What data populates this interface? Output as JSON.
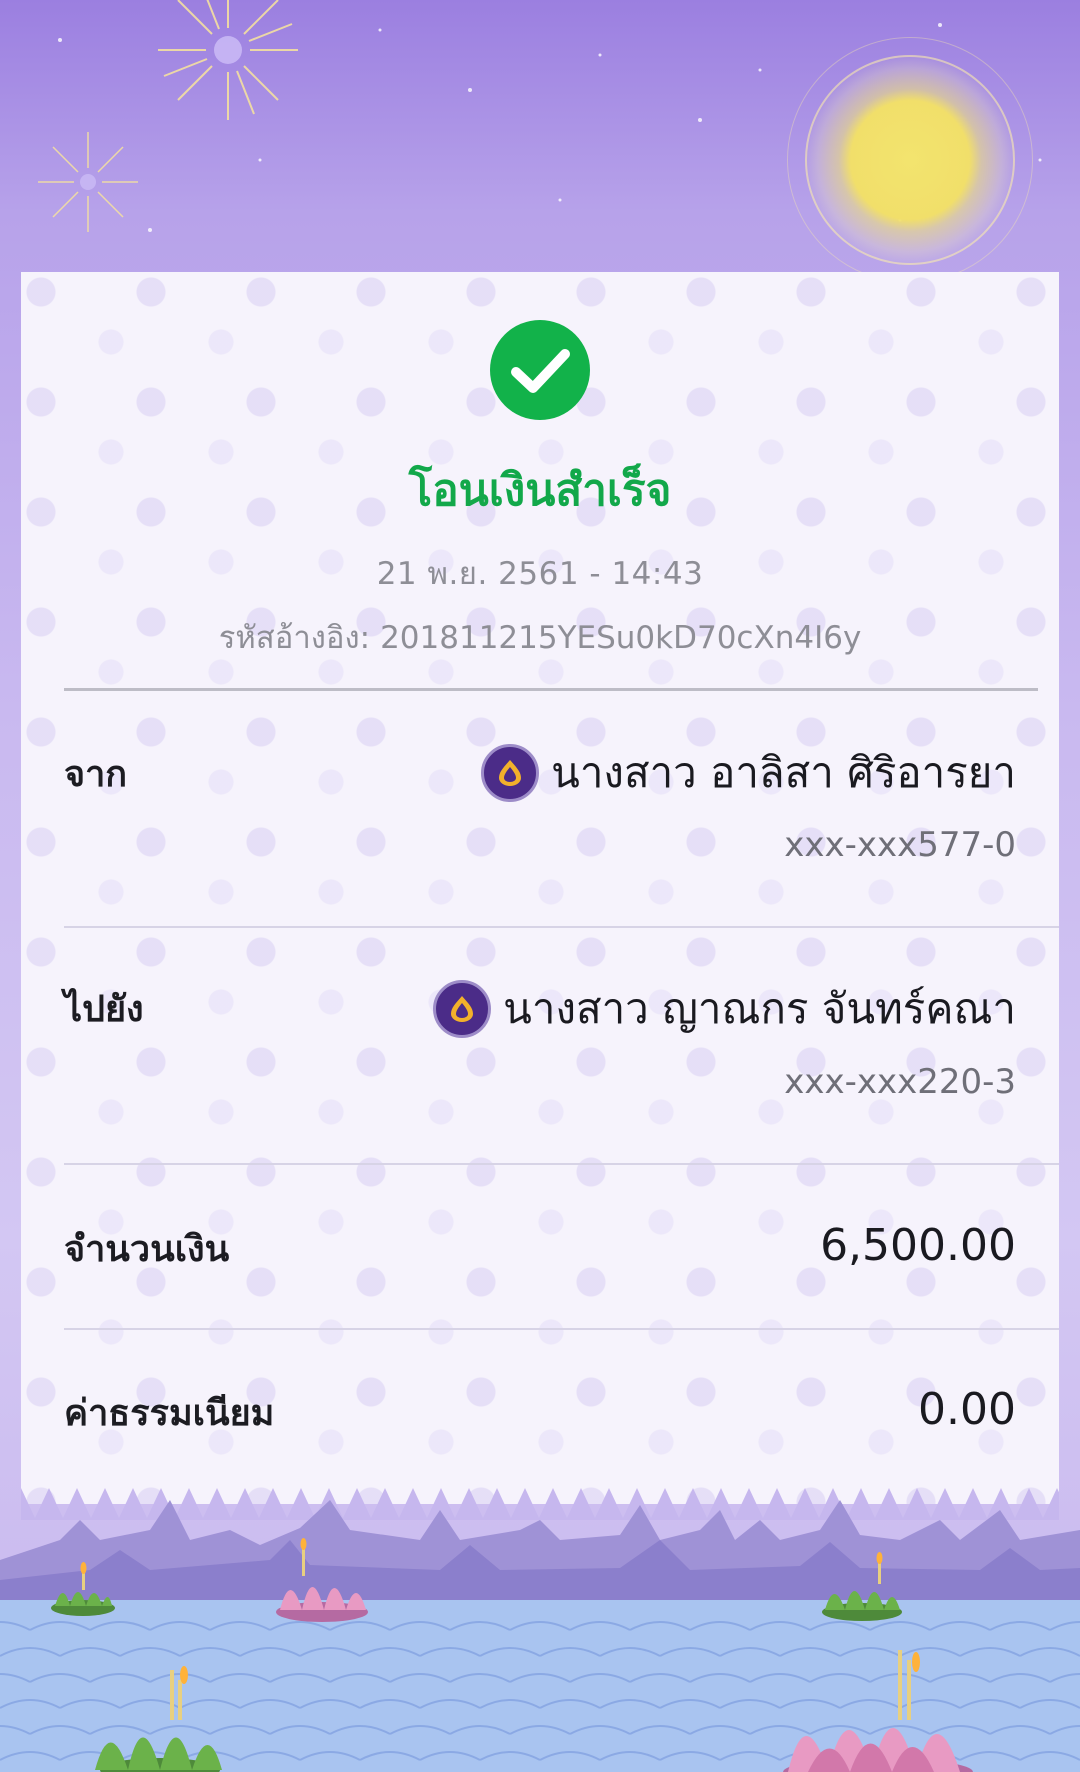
{
  "status": {
    "title": "โอนเงินสำเร็จ",
    "datetime": "21 พ.ย. 2561 - 14:43",
    "ref_label": "รหัสอ้างอิง:",
    "ref_value": "201811215YESu0kD70cXn4I6y"
  },
  "from": {
    "label": "จาก",
    "name": "นางสาว อาลิสา ศิริอารยา",
    "account": "xxx-xxx577-0",
    "bank_icon": "scb-bank-icon"
  },
  "to": {
    "label": "ไปยัง",
    "name": "นางสาว ญาณกร จันทร์คณา",
    "account": "xxx-xxx220-3",
    "bank_icon": "scb-bank-icon"
  },
  "amount": {
    "label": "จำนวนเงิน",
    "value": "6,500.00"
  },
  "fee": {
    "label": "ค่าธรรมเนียม",
    "value": "0.00"
  },
  "colors": {
    "success": "#12b24a",
    "bank_purple": "#4b2c88",
    "bank_gold": "#f2b12b"
  }
}
